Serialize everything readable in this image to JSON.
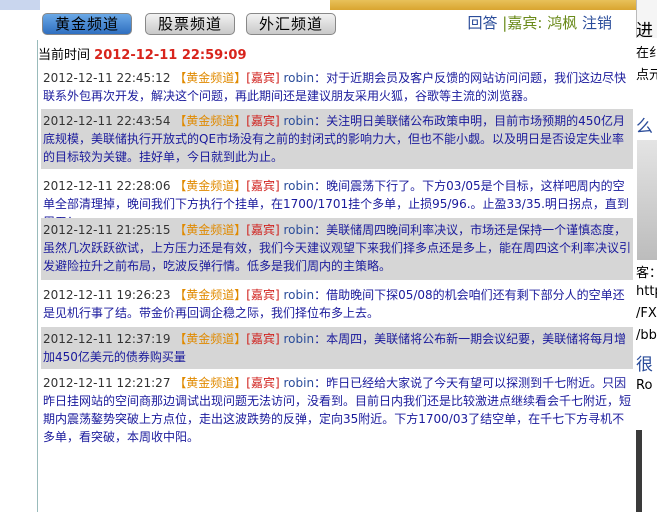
{
  "tabs": [
    {
      "label": "黄金频道",
      "active": true
    },
    {
      "label": "股票频道",
      "active": false
    },
    {
      "label": "外汇频道",
      "active": false
    }
  ],
  "user": {
    "reply": "回答",
    "guest_prefix": "|嘉宾:",
    "guest_name": "鸿枫",
    "logout": "注销"
  },
  "current_time": {
    "label": "当前时间",
    "value": "2012-12-11 22:59:09"
  },
  "messages": [
    {
      "time": "2012-12-11 22:45:12",
      "channel": "【黄金频道】",
      "role": "[嘉宾]",
      "author": "robin",
      "text": "：对于近期会员及客户反馈的网站访问问题，我们这边尽快联系外包再次开发，解决这个问题，再此期间还是建议朋友采用火狐，谷歌等主流的浏览器。"
    },
    {
      "time": "2012-12-11 22:43:54",
      "channel": "【黄金频道】",
      "role": "[嘉宾]",
      "author": "robin",
      "text": "：关注明日美联储公布政策申明，目前市场预期的450亿月底规模，美联储执行开放式的QE市场没有之前的封闭式的影响力大，但也不能小觑。以及明日是否设定失业率的目标较为关键。挂好单，今日就到此为止。"
    },
    {
      "time": "2012-12-11 22:28:06",
      "channel": "【黄金频道】",
      "role": "[嘉宾]",
      "author": "robin",
      "text": "：晚间震荡下行了。下方03/05是个目标，这样吧周内的空单全部清理掉，晚间我们下方执行个挂单，在1700/1701挂个多单，止损95/96.。止盈33/35.明日拐点，直到周五！"
    },
    {
      "time": "2012-12-11 21:25:15",
      "channel": "【黄金频道】",
      "role": "[嘉宾]",
      "author": "robin",
      "text": "：美联储周四晚间利率决议，市场还是保持一个谨慎态度，虽然几次跃跃欲试，上方压力还是有效，我们今天建议观望下来我们择多点还是多上，能在周四这个利率决议引发避险拉升之前布局，吃波反弹行情。低多是我们周内的主策略。"
    },
    {
      "time": "2012-12-11 19:26:23",
      "channel": "【黄金频道】",
      "role": "[嘉宾]",
      "author": "robin",
      "text": "：借助晚间下探05/08的机会咱们还有剩下部分人的空单还是见机行事了结。带金价再回调企稳之际，我们择位布多上去。"
    },
    {
      "time": "2012-12-11 12:37:19",
      "channel": "【黄金频道】",
      "role": "[嘉宾]",
      "author": "robin",
      "text": "：本周四，美联储将公布新一期会议纪要，美联储将每月增加450亿美元的债券购买量"
    },
    {
      "time": "2012-12-11 12:21:27",
      "channel": "【黄金频道】",
      "role": "[嘉宾]",
      "author": "robin",
      "text": "：昨日已经给大家说了今天有望可以探测到千七附近。只因昨日挂网站的空间商那边调试出现问题无法访问，没看到。目前日内我们还是比较激进点继续看会千七附近，短期内震荡鏊势突破上方点位，走出这波跌势的反弹，定向35附近。下方1700/03了结空单，在千七下方寻机不多单，看突破，本周收中阳。"
    }
  ],
  "right_pane": {
    "lines": [
      "进",
      "在纟",
      "点元",
      "么",
      "客：",
      "http",
      "/FX",
      "/bb",
      "很",
      "Ro"
    ]
  },
  "colors": {
    "active_tab": "#2f6fc0",
    "time_red": "#d8241c",
    "channel_orange": "#e08a00",
    "role_red": "#d0201c",
    "text_blue": "#1a1a9c",
    "row_gray": "#d6d6d6"
  }
}
